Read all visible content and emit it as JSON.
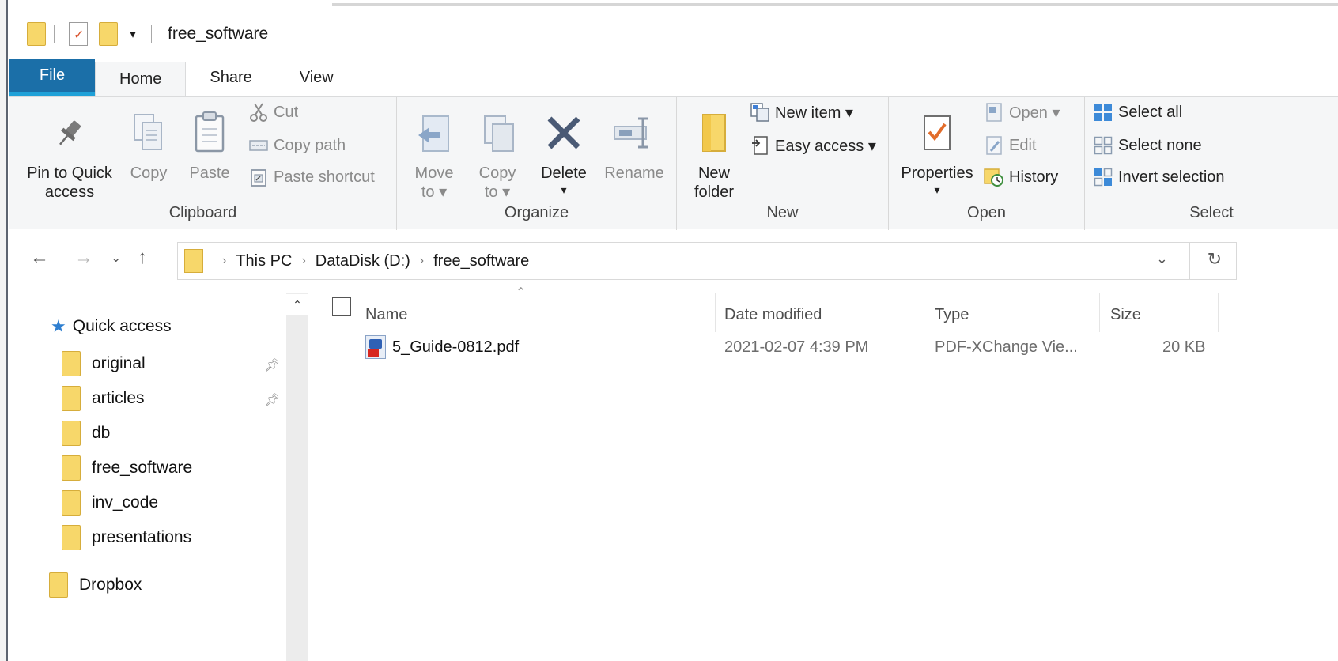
{
  "window": {
    "title": "free_software"
  },
  "tabs": [
    "File",
    "Home",
    "Share",
    "View"
  ],
  "ribbon": {
    "clipboard": {
      "label": "Clipboard",
      "pin_to_quick_access": "Pin to Quick\naccess",
      "copy": "Copy",
      "paste": "Paste",
      "cut": "Cut",
      "copy_path": "Copy path",
      "paste_shortcut": "Paste shortcut"
    },
    "organize": {
      "label": "Organize",
      "move_to": "Move\nto ▾",
      "copy_to": "Copy\nto ▾",
      "delete": "Delete",
      "rename": "Rename"
    },
    "new": {
      "label": "New",
      "new_folder": "New\nfolder",
      "new_item": "New item ▾",
      "easy_access": "Easy access ▾"
    },
    "open": {
      "label": "Open",
      "properties": "Properties",
      "open": "Open ▾",
      "edit": "Edit",
      "history": "History"
    },
    "select": {
      "label": "Select",
      "select_all": "Select all",
      "select_none": "Select none",
      "invert_selection": "Invert selection"
    }
  },
  "address": {
    "crumbs": [
      "This PC",
      "DataDisk (D:)",
      "free_software"
    ]
  },
  "nav_pane": {
    "quick_access": "Quick access",
    "items": [
      {
        "label": "original",
        "pinned": true
      },
      {
        "label": "articles",
        "pinned": true
      },
      {
        "label": "db",
        "pinned": false
      },
      {
        "label": "free_software",
        "pinned": false
      },
      {
        "label": "inv_code",
        "pinned": false
      },
      {
        "label": "presentations",
        "pinned": false
      }
    ],
    "dropbox": "Dropbox"
  },
  "file_list": {
    "columns": {
      "name": "Name",
      "date": "Date modified",
      "type": "Type",
      "size": "Size"
    },
    "files": [
      {
        "name": "5_Guide-0812.pdf",
        "date": "2021-02-07 4:39 PM",
        "type": "PDF-XChange Vie...",
        "size": "20 KB"
      }
    ]
  },
  "icons": {
    "pin": "pin-icon",
    "folder": "folder-icon",
    "star": "star-icon",
    "pdf": "pdf-file-icon"
  },
  "colors": {
    "file_tab": "#1b6fa8",
    "ribbon_bg": "#f5f6f7",
    "folder": "#f7d76a"
  }
}
